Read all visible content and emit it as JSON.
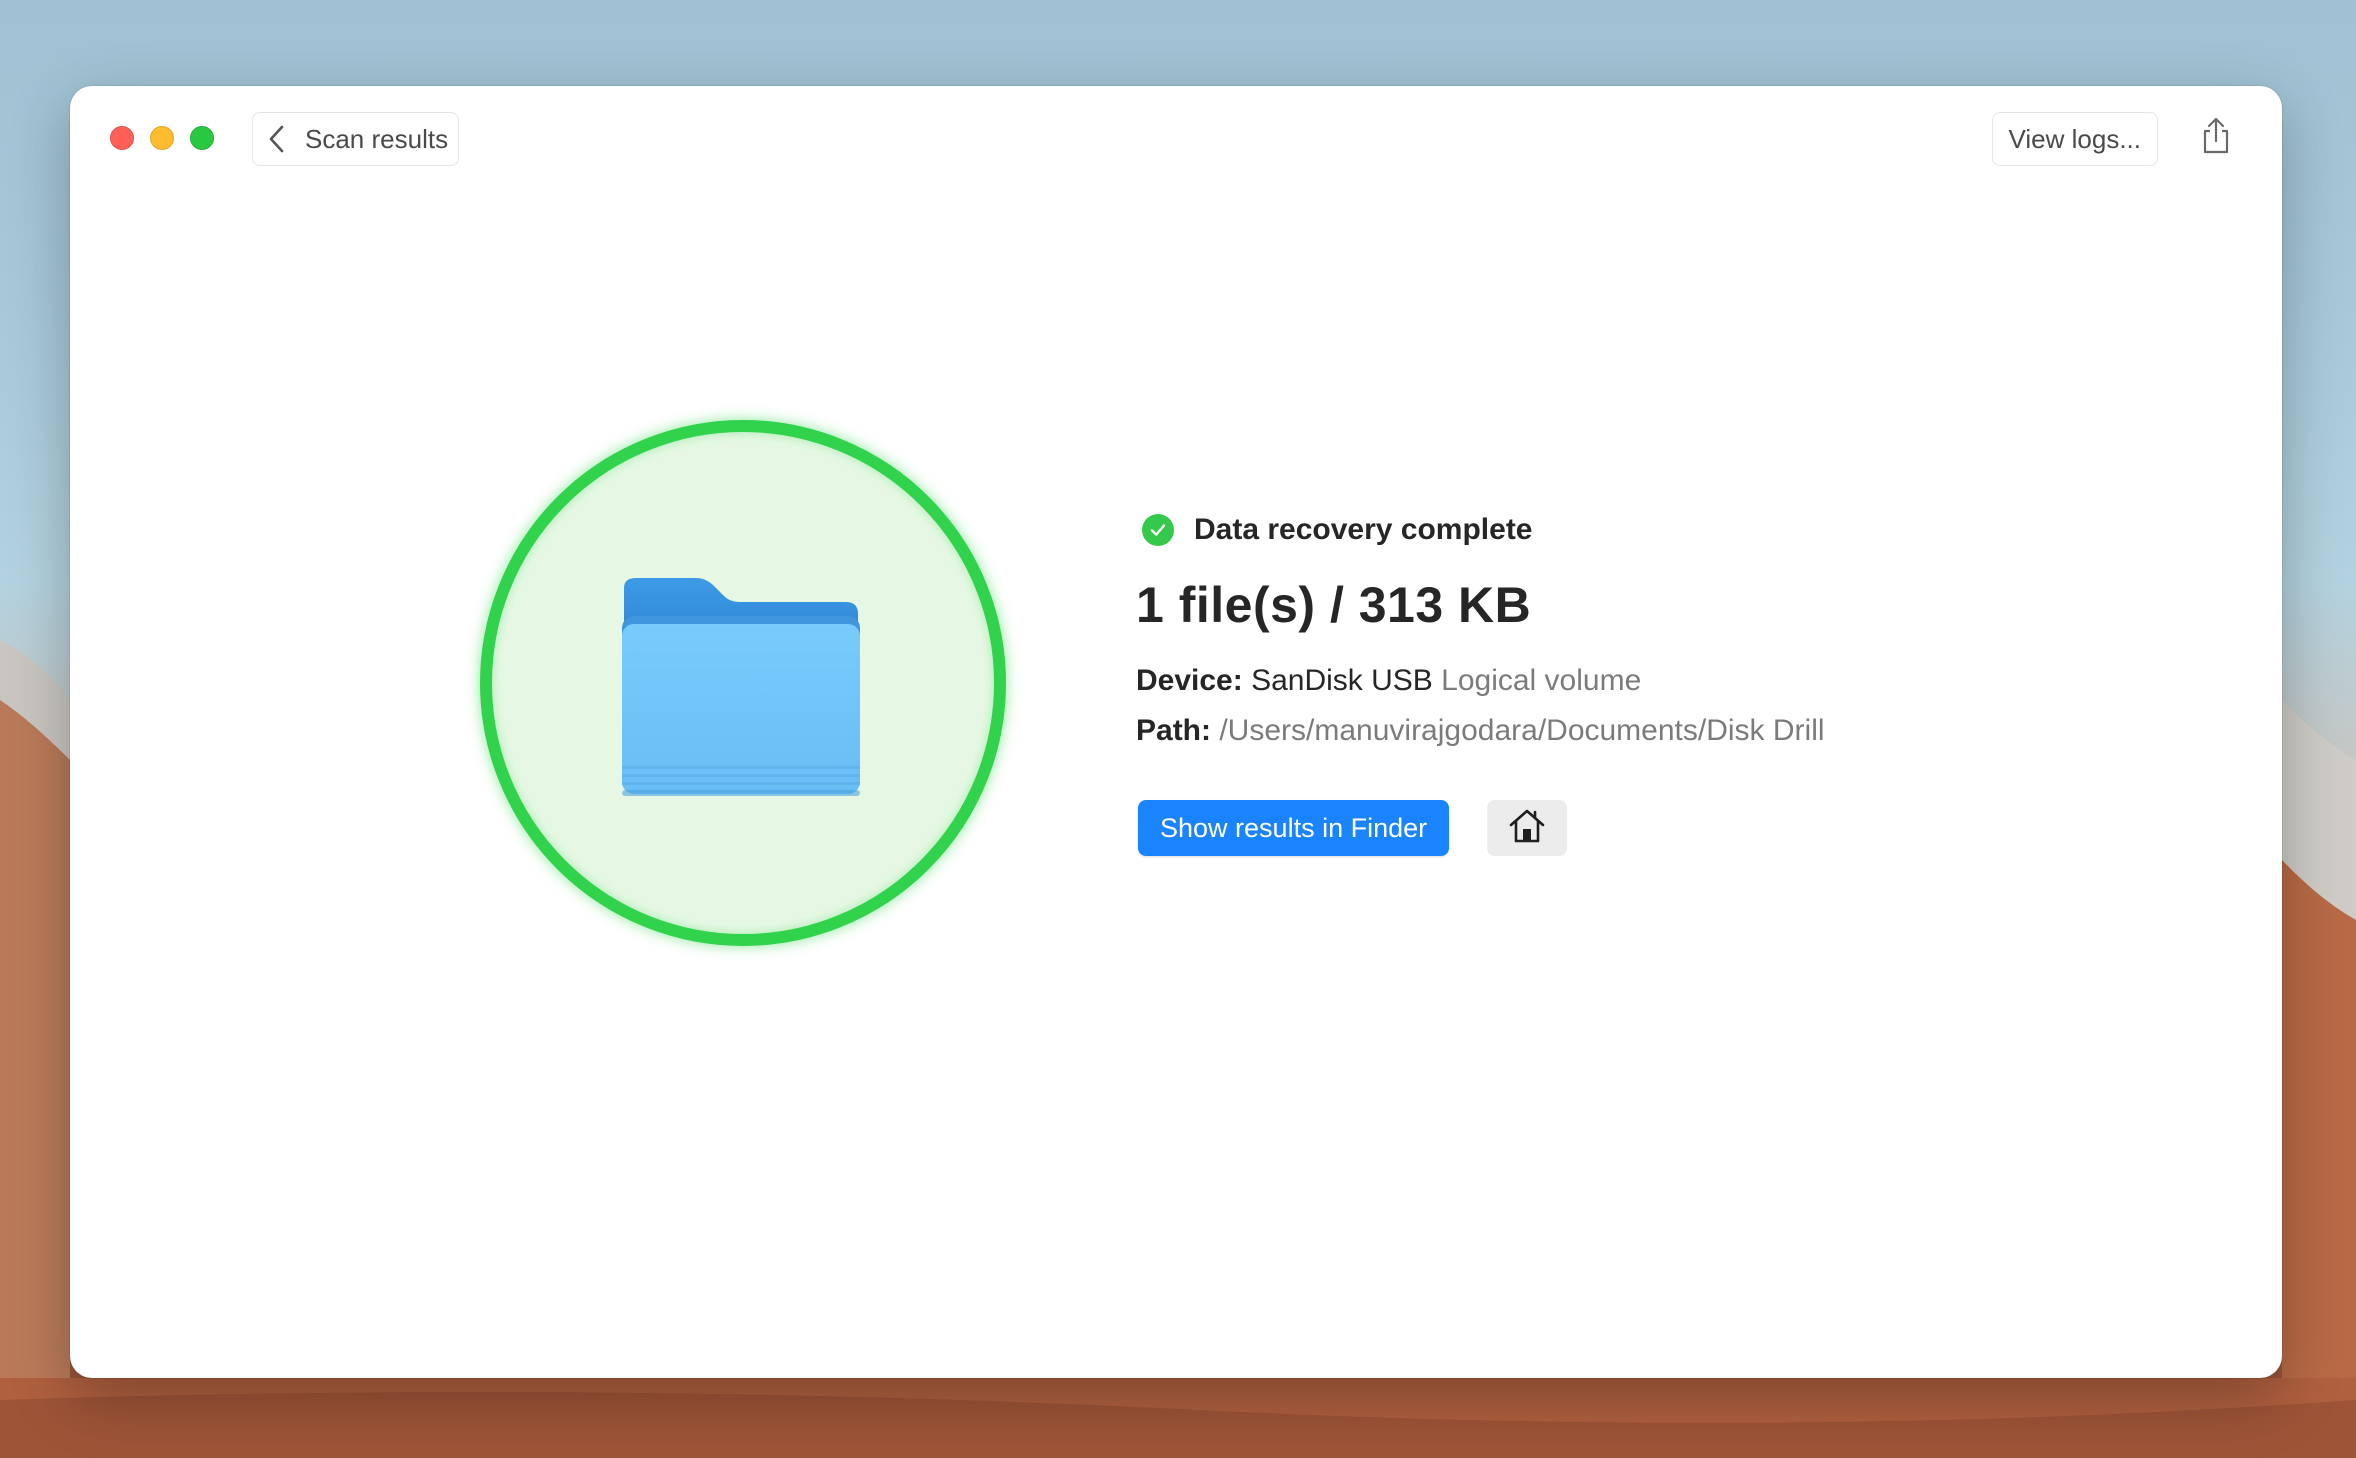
{
  "titlebar": {
    "back_label": "Scan results",
    "view_logs_label": "View logs..."
  },
  "status": {
    "title": "Data recovery complete",
    "summary": "1 file(s) / 313 KB",
    "device_key": "Device:",
    "device_name": "SanDisk USB",
    "device_type": "Logical volume",
    "path_key": "Path:",
    "path_value": "/Users/manuvirajgodara/Documents/Disk Drill"
  },
  "actions": {
    "show_finder_label": "Show results in Finder"
  },
  "icons": {
    "back": "chevron-left-icon",
    "share": "share-icon",
    "check": "checkmark-circle-icon",
    "folder": "folder-icon",
    "home": "home-icon"
  },
  "colors": {
    "accent": "#1a84ff",
    "success": "#31d34c",
    "ring_fill": "#e6f8e4"
  }
}
